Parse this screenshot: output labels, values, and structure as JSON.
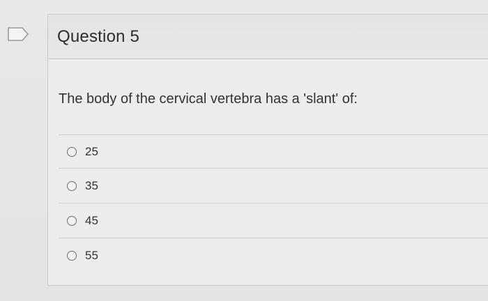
{
  "question": {
    "title": "Question 5",
    "text": "The body of the cervical vertebra has a 'slant' of:"
  },
  "options": [
    {
      "label": "25",
      "selected": false
    },
    {
      "label": "35",
      "selected": false
    },
    {
      "label": "45",
      "selected": false
    },
    {
      "label": "55",
      "selected": false
    }
  ],
  "icons": {
    "flag": "flag-icon",
    "radio": "radio-button-icon"
  },
  "colors": {
    "background": "#e6e6e4",
    "header": "#e4e4e2",
    "text": "#333333"
  }
}
